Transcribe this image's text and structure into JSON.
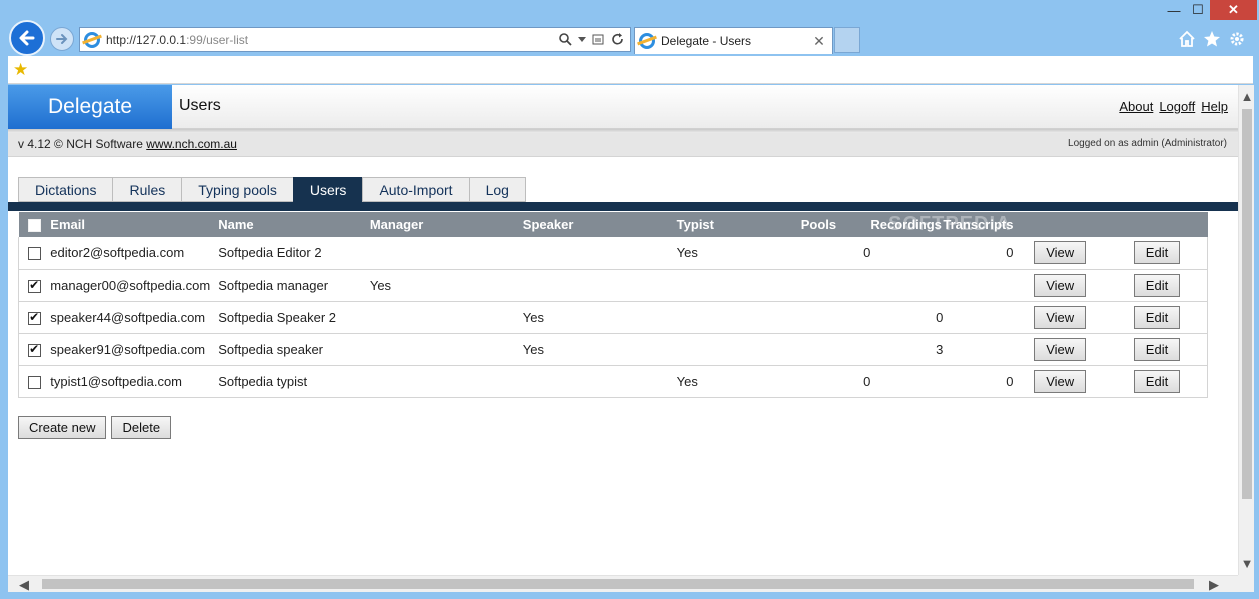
{
  "browser": {
    "url_host": "http://127.0.0.1",
    "url_path": ":99/user-list",
    "tab_title": "Delegate - Users",
    "tab_close": "✕",
    "win_min": "—",
    "win_max": "☐",
    "win_close": "✕",
    "icons": [
      "back-arrow-icon",
      "forward-arrow-icon",
      "ie-logo-icon",
      "search-icon",
      "dropdown-icon",
      "compat-icon",
      "refresh-icon",
      "home-icon",
      "favorites-star-icon",
      "settings-gear-icon",
      "add-favorite-icon"
    ]
  },
  "app": {
    "brand": "Delegate",
    "page_title": "Users",
    "links": {
      "about": "About",
      "logoff": "Logoff",
      "help": "Help"
    },
    "version_text": "v 4.12 © NCH Software",
    "version_link": "www.nch.com.au",
    "logged_on": "Logged on as admin (Administrator)",
    "watermark": "SOFTPEDIA"
  },
  "tabs": [
    {
      "label": "Dictations",
      "active": false
    },
    {
      "label": "Rules",
      "active": false
    },
    {
      "label": "Typing pools",
      "active": false
    },
    {
      "label": "Users",
      "active": true
    },
    {
      "label": "Auto-Import",
      "active": false
    },
    {
      "label": "Log",
      "active": false
    }
  ],
  "table": {
    "columns": [
      "Email",
      "Name",
      "Manager",
      "Speaker",
      "Typist",
      "Pools",
      "Recordings",
      "Transcripts"
    ],
    "view_label": "View",
    "edit_label": "Edit",
    "rows": [
      {
        "checked": false,
        "email": "editor2@softpedia.com",
        "name": "Softpedia Editor 2",
        "manager": "",
        "speaker": "",
        "typist": "Yes",
        "pools": "0",
        "recordings": "",
        "transcripts": "0"
      },
      {
        "checked": true,
        "email": "manager00@softpedia.com",
        "name": "Softpedia manager",
        "manager": "Yes",
        "speaker": "",
        "typist": "",
        "pools": "",
        "recordings": "",
        "transcripts": ""
      },
      {
        "checked": true,
        "email": "speaker44@softpedia.com",
        "name": "Softpedia Speaker 2",
        "manager": "",
        "speaker": "Yes",
        "typist": "",
        "pools": "",
        "recordings": "0",
        "transcripts": ""
      },
      {
        "checked": true,
        "email": "speaker91@softpedia.com",
        "name": "Softpedia speaker",
        "manager": "",
        "speaker": "Yes",
        "typist": "",
        "pools": "",
        "recordings": "3",
        "transcripts": ""
      },
      {
        "checked": false,
        "email": "typist1@softpedia.com",
        "name": "Softpedia typist",
        "manager": "",
        "speaker": "",
        "typist": "Yes",
        "pools": "0",
        "recordings": "",
        "transcripts": "0"
      }
    ]
  },
  "actions": {
    "create": "Create new",
    "delete": "Delete"
  },
  "colors": {
    "brand_blue": "#1f6fd0",
    "tab_navy": "#16324f",
    "header_gray": "#828b94"
  }
}
